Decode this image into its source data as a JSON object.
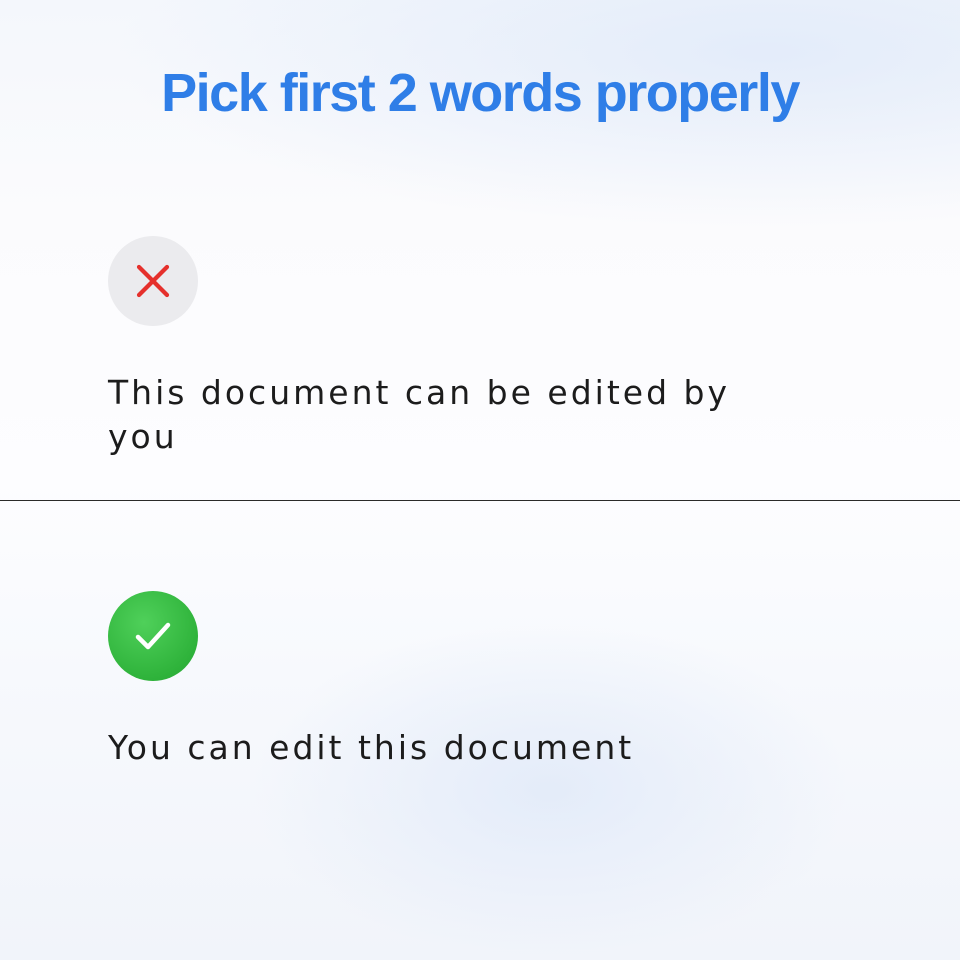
{
  "colors": {
    "title": "#2f7ee7",
    "error": "#e5302c",
    "success": "#34b840",
    "text": "#1c1c1c"
  },
  "title": "Pick first 2 words properly",
  "examples": [
    {
      "status": "incorrect",
      "icon": "x-mark-icon",
      "text": "This document can be edited by you"
    },
    {
      "status": "correct",
      "icon": "checkmark-icon",
      "text": "You can edit this document"
    }
  ]
}
